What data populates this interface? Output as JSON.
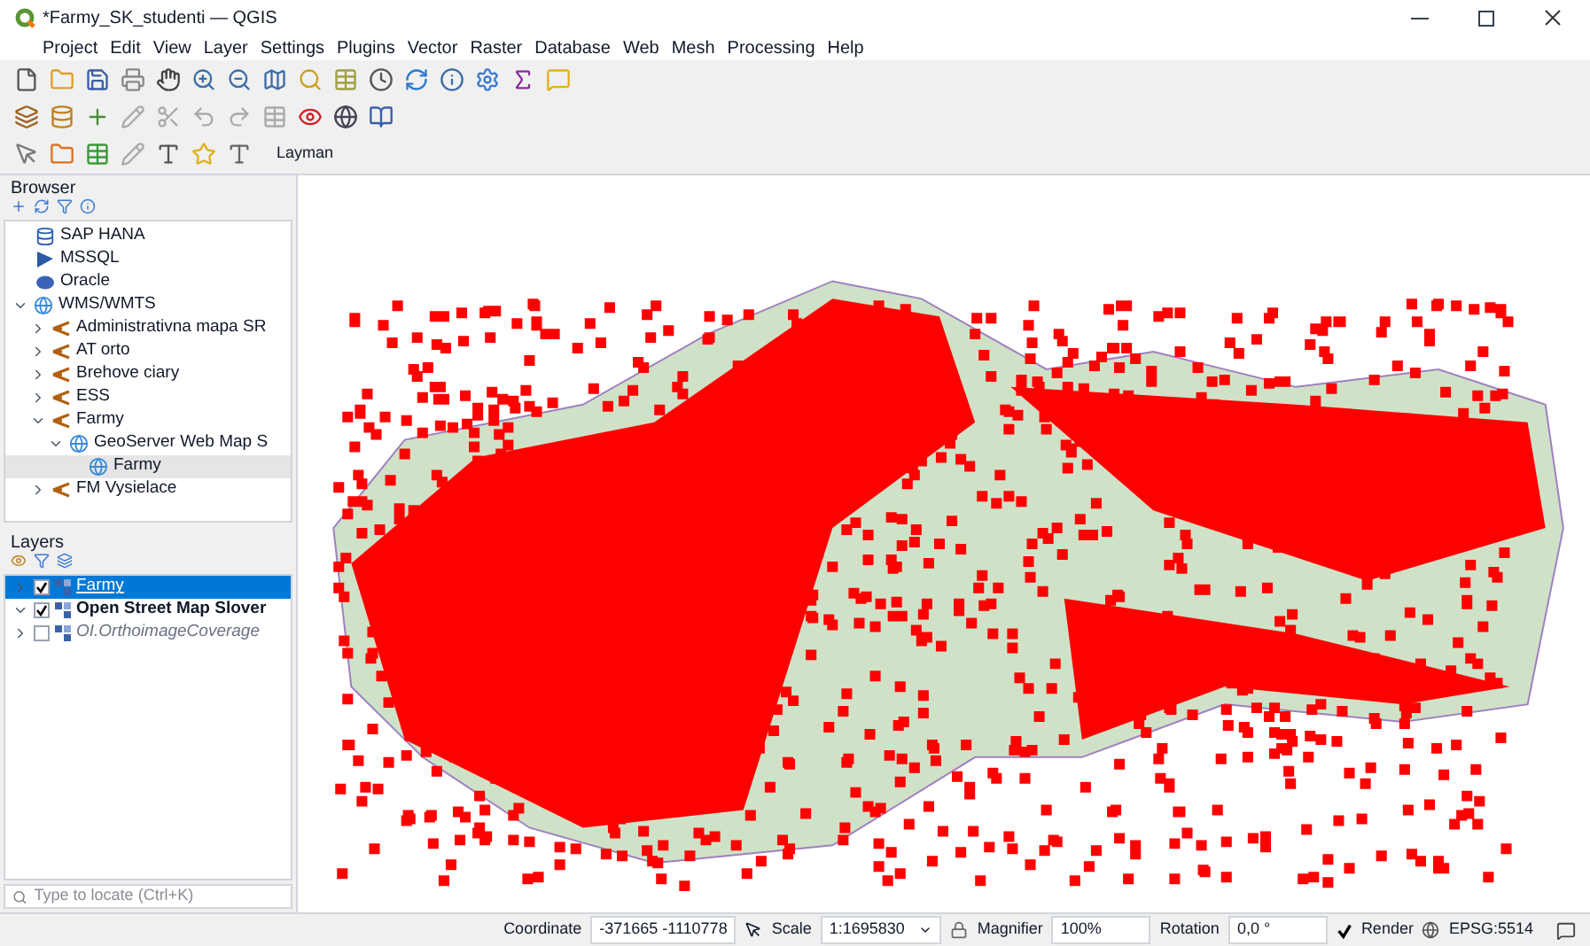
{
  "window": {
    "title": "*Farmy_SK_studenti — QGIS"
  },
  "menu": [
    "Project",
    "Edit",
    "View",
    "Layer",
    "Settings",
    "Plugins",
    "Vector",
    "Raster",
    "Database",
    "Web",
    "Mesh",
    "Processing",
    "Help"
  ],
  "toolbar_label": "Layman",
  "browser": {
    "title": "Browser",
    "items": [
      {
        "label": "SAP HANA",
        "kind": "hana",
        "selected": false
      },
      {
        "label": "MSSQL",
        "kind": "mssql",
        "selected": false
      },
      {
        "label": "Oracle",
        "kind": "oracle",
        "selected": false
      },
      {
        "label": "WMS/WMTS",
        "kind": "globe",
        "expanded": true,
        "selected": false,
        "children": [
          {
            "label": "Administrativna mapa SR",
            "kind": "conn",
            "expanded": false,
            "selected": false
          },
          {
            "label": "AT orto",
            "kind": "conn",
            "expanded": false,
            "selected": false
          },
          {
            "label": "Brehove ciary",
            "kind": "conn",
            "expanded": false,
            "selected": false
          },
          {
            "label": "ESS",
            "kind": "conn",
            "expanded": false,
            "selected": false
          },
          {
            "label": "Farmy",
            "kind": "conn",
            "expanded": true,
            "selected": false,
            "children": [
              {
                "label": "GeoServer Web Map S",
                "kind": "globe",
                "expanded": true,
                "selected": false,
                "children": [
                  {
                    "label": "Farmy",
                    "kind": "globe",
                    "selected": true
                  }
                ]
              }
            ]
          },
          {
            "label": "FM Vysielace",
            "kind": "conn",
            "expanded": false,
            "selected": false
          }
        ]
      }
    ]
  },
  "layers": {
    "title": "Layers",
    "items": [
      {
        "label": "Farmy",
        "checked": true,
        "expanded": false,
        "selected": true,
        "kind": "link"
      },
      {
        "label": "Open Street Map Slover",
        "checked": true,
        "expanded": true,
        "selected": false,
        "kind": "bold"
      },
      {
        "label": "OI.OrthoimageCoverage",
        "checked": false,
        "expanded": false,
        "selected": false,
        "kind": "italic"
      }
    ]
  },
  "status_bar": {
    "locate_placeholder": "Type to locate (Ctrl+K)",
    "coordinate_label": "Coordinate",
    "coordinate": "-371665 -1110778",
    "scale_label": "Scale",
    "scale": "1:1695830",
    "magnifier_label": "Magnifier",
    "magnifier": "100%",
    "rotation_label": "Rotation",
    "rotation": "0,0 °",
    "render_label": "Render",
    "render_checked": true,
    "crs": "EPSG:5514"
  }
}
